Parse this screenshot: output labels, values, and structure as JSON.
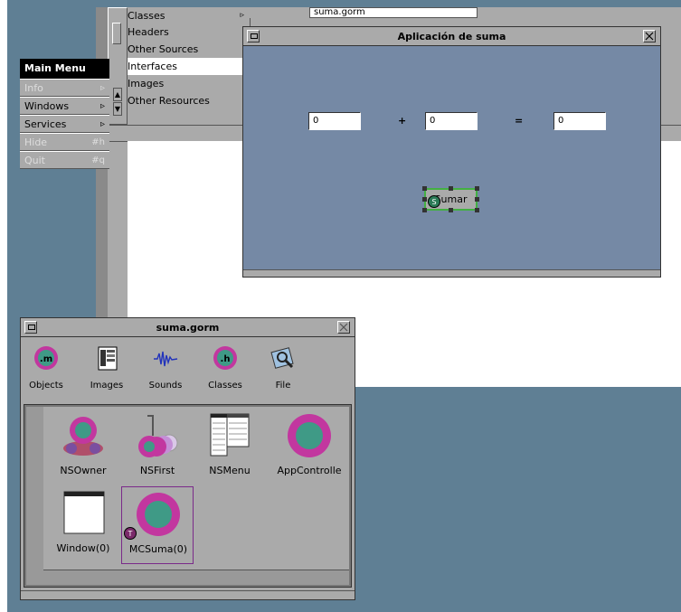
{
  "project_browser": {
    "list_items": [
      {
        "label": "Classes",
        "arrow": "▹"
      },
      {
        "label": "Headers",
        "arrow": ""
      },
      {
        "label": "Other Sources",
        "arrow": ""
      },
      {
        "label": "Interfaces",
        "arrow": "",
        "selected": true
      },
      {
        "label": "Images",
        "arrow": ""
      },
      {
        "label": "Other Resources",
        "arrow": ""
      }
    ],
    "top_field": "suma.gorm"
  },
  "main_menu": {
    "title": "Main Menu",
    "items": [
      {
        "label": "Info",
        "key": "▹",
        "enabled": false
      },
      {
        "label": "Windows",
        "key": "▹",
        "enabled": true
      },
      {
        "label": "Services",
        "key": "▹",
        "enabled": true
      },
      {
        "label": "Hide",
        "key": "#h",
        "enabled": false
      },
      {
        "label": "Quit",
        "key": "#q",
        "enabled": false
      }
    ]
  },
  "app_window": {
    "title": "Aplicación de suma",
    "field1": "0",
    "plus": "+",
    "field2": "0",
    "equals": "=",
    "result": "0",
    "button_label": "Sumar",
    "button_badge": "S"
  },
  "gorm_window": {
    "title": "suma.gorm",
    "toolbar": [
      "Objects",
      "Images",
      "Sounds",
      "Classes",
      "File"
    ],
    "toolbar_icon_text": {
      "objects": ".m",
      "classes": ".h"
    },
    "objects": [
      {
        "label": "NSOwner"
      },
      {
        "label": "NSFirst"
      },
      {
        "label": "NSMenu"
      },
      {
        "label": "AppControlle"
      },
      {
        "label": "Window(0)"
      },
      {
        "label": "MCSuma(0)"
      }
    ],
    "mcsuma_badge": "T"
  },
  "colors": {
    "desktop": "#5f7f94",
    "app_body": "#7589a5",
    "window_gray": "#aaaaaa",
    "magenta": "#c2379f",
    "teal": "#3f9a86",
    "selection_green": "#43b043"
  }
}
